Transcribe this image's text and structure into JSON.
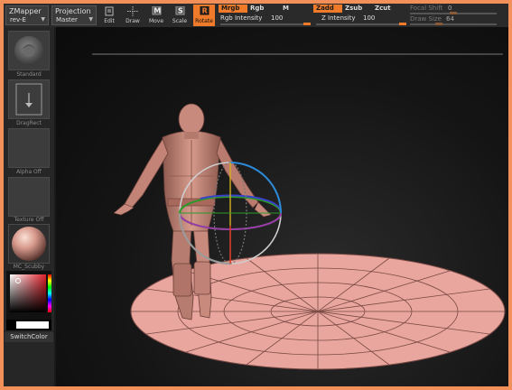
{
  "menus": {
    "zmapper": {
      "title": "ZMapper",
      "version": "rev-E"
    },
    "projection": {
      "title": "Projection",
      "value": "Master"
    }
  },
  "tools": [
    {
      "label": "Edit",
      "icon": "edit-icon",
      "active": false
    },
    {
      "label": "Draw",
      "icon": "draw-icon",
      "active": false
    },
    {
      "label": "Move",
      "icon": "move-icon",
      "active": false
    },
    {
      "label": "Scale",
      "icon": "scale-icon",
      "active": false
    },
    {
      "label": "Rotate",
      "icon": "rotate-icon",
      "active": true
    }
  ],
  "rgb_controls": {
    "mrgb": "Mrgb",
    "rgb": "Rgb",
    "m": "M",
    "intensity_label": "Rgb Intensity",
    "intensity_value": "100",
    "intensity_fraction": 1.0
  },
  "z_controls": {
    "zadd": "Zadd",
    "zsub": "Zsub",
    "zcut": "Zcut",
    "intensity_label": "Z Intensity",
    "intensity_value": "100",
    "intensity_fraction": 1.0
  },
  "focal_shift": {
    "label": "Focal Shift",
    "value": "0",
    "fraction": 0.5
  },
  "draw_size": {
    "label": "Draw Size",
    "value": "64",
    "fraction": 0.3
  },
  "left_panel": {
    "brush_label": "Standard",
    "stroke_label": "DragRect",
    "alpha_label": "Alpha Off",
    "texture_label": "Texture Off",
    "material_label": "MC_Scubby",
    "switch_color": "SwitchColor"
  },
  "colors": {
    "accent": "#ee7a2a",
    "frame": "#f3905a",
    "model_skin": "#c98a7e",
    "plane": "#e8a69e"
  }
}
